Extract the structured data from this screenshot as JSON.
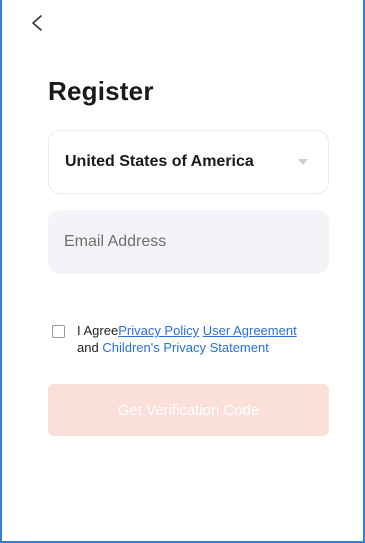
{
  "header": {
    "back_icon": "chevron-left-icon",
    "title": "Register"
  },
  "form": {
    "country_value": "United States of America",
    "email_placeholder": "Email Address",
    "agree": {
      "prefix": "I Agree",
      "privacy_policy": "Privacy Policy",
      "user_agreement": "User Agreement",
      "and": "and",
      "children_privacy": "Children's Privacy Statement"
    },
    "submit_label": "Get Verification Code"
  },
  "colors": {
    "frame_border": "#2f7fdc",
    "link": "#2a6fd6",
    "button_disabled": "#fbe0da",
    "input_bg": "#f3f4f8"
  }
}
